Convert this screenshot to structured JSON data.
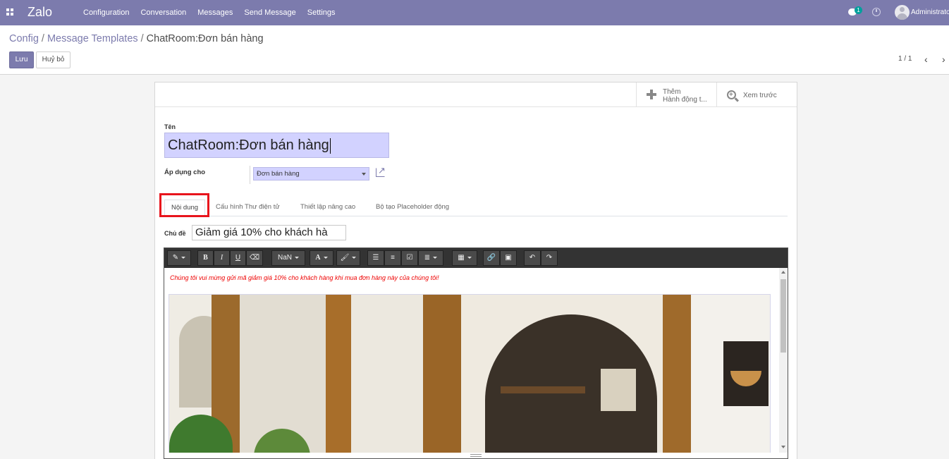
{
  "app": {
    "brand": "Zalo",
    "menu": [
      "Configuration",
      "Conversation",
      "Messages",
      "Send Message",
      "Settings"
    ],
    "chat_badge": "1",
    "user_name": "Administrator"
  },
  "breadcrumb": {
    "config": "Config",
    "templates": "Message Templates",
    "current": "ChatRoom:Đơn bán hàng"
  },
  "actions": {
    "save": "Lưu",
    "discard": "Huỷ bỏ"
  },
  "pager": {
    "value": "1 / 1",
    "prev": "‹",
    "next": "›"
  },
  "button_box": {
    "add_action_line1": "Thêm",
    "add_action_line2": "Hành động t...",
    "preview": "Xem trước"
  },
  "form": {
    "name_label": "Tên",
    "name_value": "ChatRoom:Đơn bán hàng",
    "apply_label": "Áp dụng cho",
    "apply_value": "Đơn bán hàng",
    "subject_label": "Chủ đề",
    "subject_value": "Giảm giá 10% cho khách hà"
  },
  "tabs": [
    "Nội dung",
    "Cấu hình Thư điện tử",
    "Thiết lập nâng cao",
    "Bộ tạo Placeholder động"
  ],
  "editor": {
    "font_size_label": "NaN",
    "bold": "B",
    "italic": "I",
    "underline": "U",
    "font_color": "A",
    "intro_text": "Chúng tôi vui mừng gửi mã giảm giá 10% cho khách hàng khi mua đơn hàng này của chúng tôi!"
  },
  "colors": {
    "nav": "#7c7bad",
    "primary_button": "#7c7bad",
    "input_highlight": "#d2d2ff",
    "tab_highlight_box": "#e8141c",
    "intro_text": "#e00000"
  },
  "icons": {
    "apps": "apps-grid-icon",
    "chat": "chat-icon",
    "activity": "clock-icon",
    "add_action": "plus-icon",
    "preview": "zoom-in-icon",
    "external_link": "external-link-icon"
  }
}
